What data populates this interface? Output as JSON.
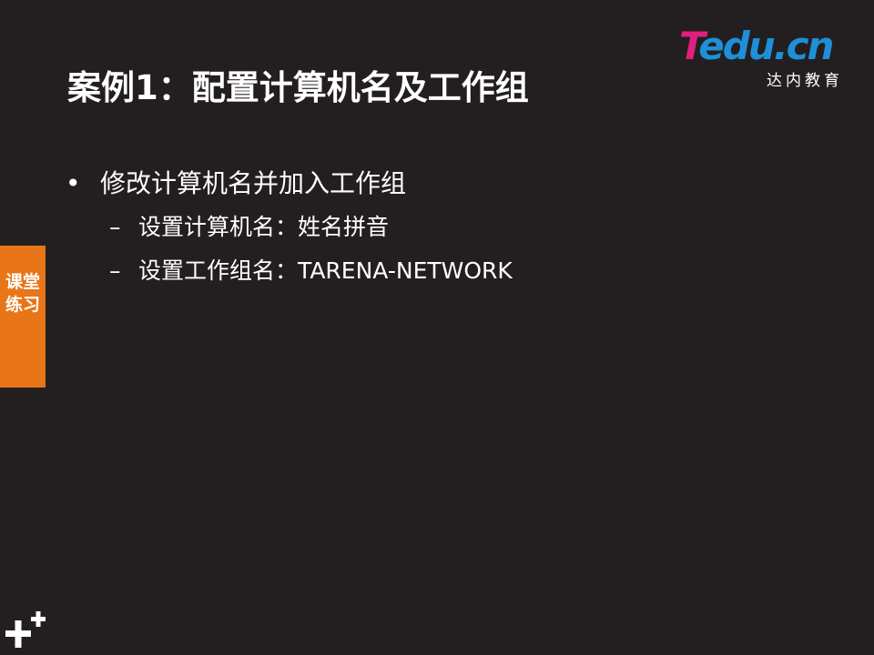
{
  "logo": {
    "brand_t": "T",
    "brand_rest": "edu.cn",
    "subtitle": "达内教育"
  },
  "title": "案例1：配置计算机名及工作组",
  "bullets": [
    {
      "marker": "•",
      "text": "修改计算机名并加入工作组",
      "children": [
        {
          "marker": "–",
          "text": "设置计算机名：姓名拼音"
        },
        {
          "marker": "–",
          "text": "设置工作组名：TARENA-NETWORK"
        }
      ]
    }
  ],
  "side_tab": {
    "label": "课堂练习"
  },
  "colors": {
    "background": "#231f20",
    "accent_orange": "#e87518",
    "brand_pink": "#e0207e",
    "brand_blue": "#1e8fd8"
  },
  "icons": {
    "decoration": "plus-plus-icon"
  }
}
